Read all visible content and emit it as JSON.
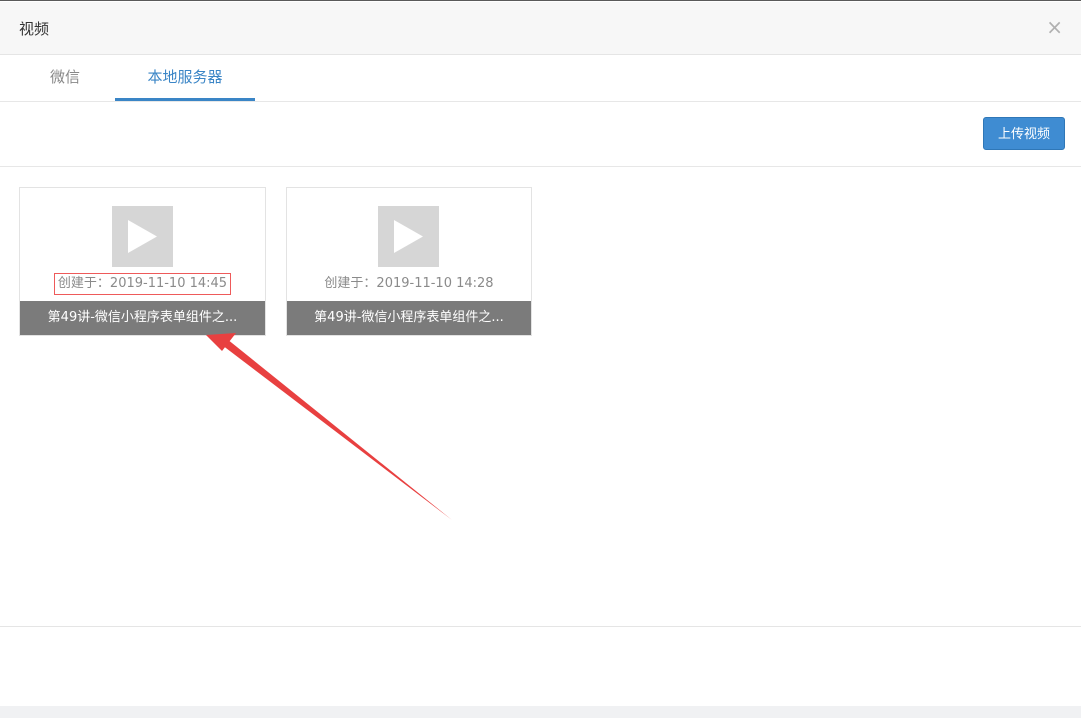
{
  "dialog": {
    "title": "视频",
    "close_glyph": "×"
  },
  "tabs": [
    {
      "label": "微信",
      "active": false
    },
    {
      "label": "本地服务器",
      "active": true
    }
  ],
  "toolbar": {
    "upload_label": "上传视频"
  },
  "videos": [
    {
      "created": "创建于：2019-11-10 14:45",
      "title": "第49讲-微信小程序表单组件之...",
      "highlighted": true
    },
    {
      "created": "创建于：2019-11-10 14:28",
      "title": "第49讲-微信小程序表单组件之...",
      "highlighted": false
    }
  ],
  "colors": {
    "accent": "#3a85c6",
    "button": "#3f8cd2",
    "caption_bg": "#7b7b7b",
    "annotation": "#e84040"
  },
  "icons": {
    "close": "close-icon",
    "thumbnail": "play-icon"
  }
}
